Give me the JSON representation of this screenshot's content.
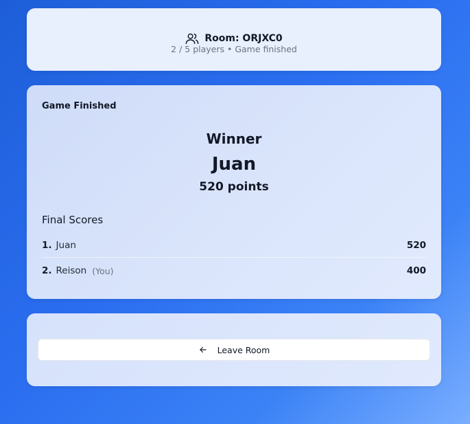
{
  "room": {
    "title": "Room: ORJXC0",
    "subtitle": "2 / 5 players • Game finished",
    "icon": "users-icon"
  },
  "game": {
    "status": "Game Finished",
    "winner_label": "Winner",
    "winner_name": "Juan",
    "winner_points": "520 points",
    "scores_title": "Final Scores",
    "scores": [
      {
        "rank": "1.",
        "name": "Juan",
        "you": "",
        "score": "520"
      },
      {
        "rank": "2.",
        "name": "Reison",
        "you": "(You)",
        "score": "400"
      }
    ]
  },
  "actions": {
    "leave_label": "Leave Room",
    "leave_icon": "arrow-left-icon"
  }
}
